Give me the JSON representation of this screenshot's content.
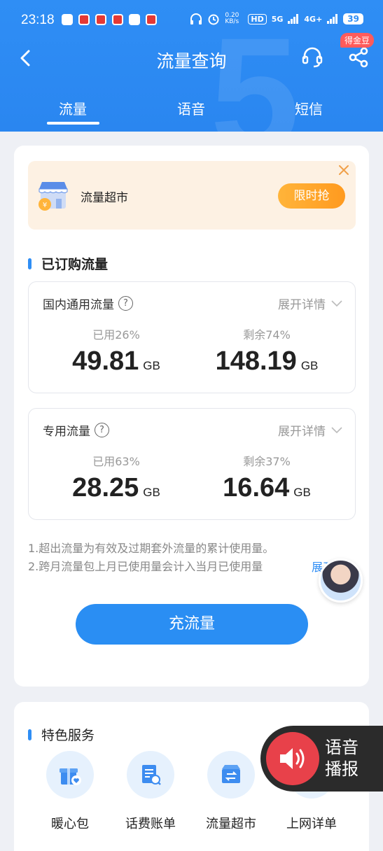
{
  "status_bar": {
    "time": "23:18",
    "net_speed": "0.20 KB/s",
    "hd_tag": "HD",
    "net_5g": "5G",
    "net_4g": "4G+",
    "battery": "39"
  },
  "header": {
    "title": "流量查询",
    "badge": "得金豆"
  },
  "tabs": [
    {
      "label": "流量",
      "active": true
    },
    {
      "label": "语音"
    },
    {
      "label": "短信"
    }
  ],
  "market_banner": {
    "label": "流量超市",
    "button": "限时抢"
  },
  "subscribed": {
    "section_title": "已订购流量",
    "boxes": [
      {
        "title": "国内通用流量",
        "expand": "展开详情",
        "used_label": "已用26%",
        "used_value": "49.81",
        "remain_label": "剩余74%",
        "remain_value": "148.19",
        "unit": "GB"
      },
      {
        "title": "专用流量",
        "expand": "展开详情",
        "used_label": "已用63%",
        "used_value": "28.25",
        "remain_label": "剩余37%",
        "remain_value": "16.64",
        "unit": "GB"
      }
    ]
  },
  "notes": {
    "line1": "1.超出流量为有效及过期套外流量的累计使用量。",
    "line2": "2.跨月流量包上月已使用量会计入当月已使用量",
    "expand_link": "展开"
  },
  "cta": {
    "label": "充流量"
  },
  "services": {
    "section_title": "特色服务",
    "items": [
      {
        "label": "暖心包",
        "icon": "gift-heart-icon"
      },
      {
        "label": "话费账单",
        "icon": "bill-search-icon"
      },
      {
        "label": "流量超市",
        "icon": "market-box-icon"
      },
      {
        "label": "上网详单",
        "icon": "detail-list-icon"
      }
    ]
  },
  "voice_float": {
    "line1": "语音",
    "line2": "播报"
  },
  "colors": {
    "primary": "#2f8ef5",
    "accent_orange": "#ff9a1f",
    "voice_red": "#e8414a"
  }
}
